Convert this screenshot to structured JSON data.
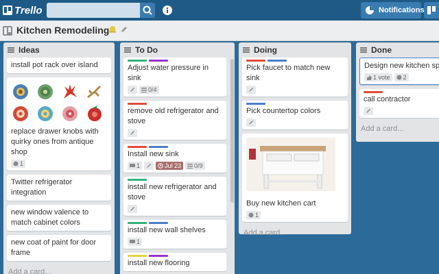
{
  "header": {
    "logo_text": "Trello",
    "search_placeholder": "",
    "notifications_label": "Notifications"
  },
  "board": {
    "title": "Kitchen Remodeling"
  },
  "colors": {
    "green": "#34b27d",
    "purple": "#9933cc",
    "red": "#e34b3a",
    "blue": "#4a7ecb",
    "yellow": "#e0d43b"
  },
  "lists": [
    {
      "name": "Ideas",
      "add_card": "Add a card...",
      "cards": [
        {
          "title": "install pot rack over island"
        },
        {
          "title": "replace drawer knobs with quirky ones from antique shop",
          "comments": "1"
        },
        {
          "title": "Twitter refrigerator integration"
        },
        {
          "title": "new window valence to match cabinet colors"
        },
        {
          "title": "new coat of paint for door frame"
        }
      ]
    },
    {
      "name": "To Do",
      "cards": [
        {
          "title": "Adjust water pressure in sink",
          "checklist": "0/4"
        },
        {
          "title": "remove old refrigerator and stove"
        },
        {
          "title": "Install new sink",
          "comments": "1",
          "due": "Jul 23",
          "checklist": "0/9"
        },
        {
          "title": "install new refrigerator and stove"
        },
        {
          "title": "install new wall shelves",
          "comments": "1"
        },
        {
          "title": "install new flooring"
        }
      ]
    },
    {
      "name": "Doing",
      "add_card": "Add a card...",
      "cards": [
        {
          "title": "Pick faucet to match new sink"
        },
        {
          "title": "Pick countertop colors"
        },
        {
          "title": "Buy new kitchen cart",
          "comments": "1"
        }
      ]
    },
    {
      "name": "Done",
      "add_card": "Add a card...",
      "cards": [
        {
          "title": "Design new kitchen spa",
          "votes": "1 vote",
          "comments": "2"
        },
        {
          "title": "call contractor"
        }
      ]
    }
  ]
}
